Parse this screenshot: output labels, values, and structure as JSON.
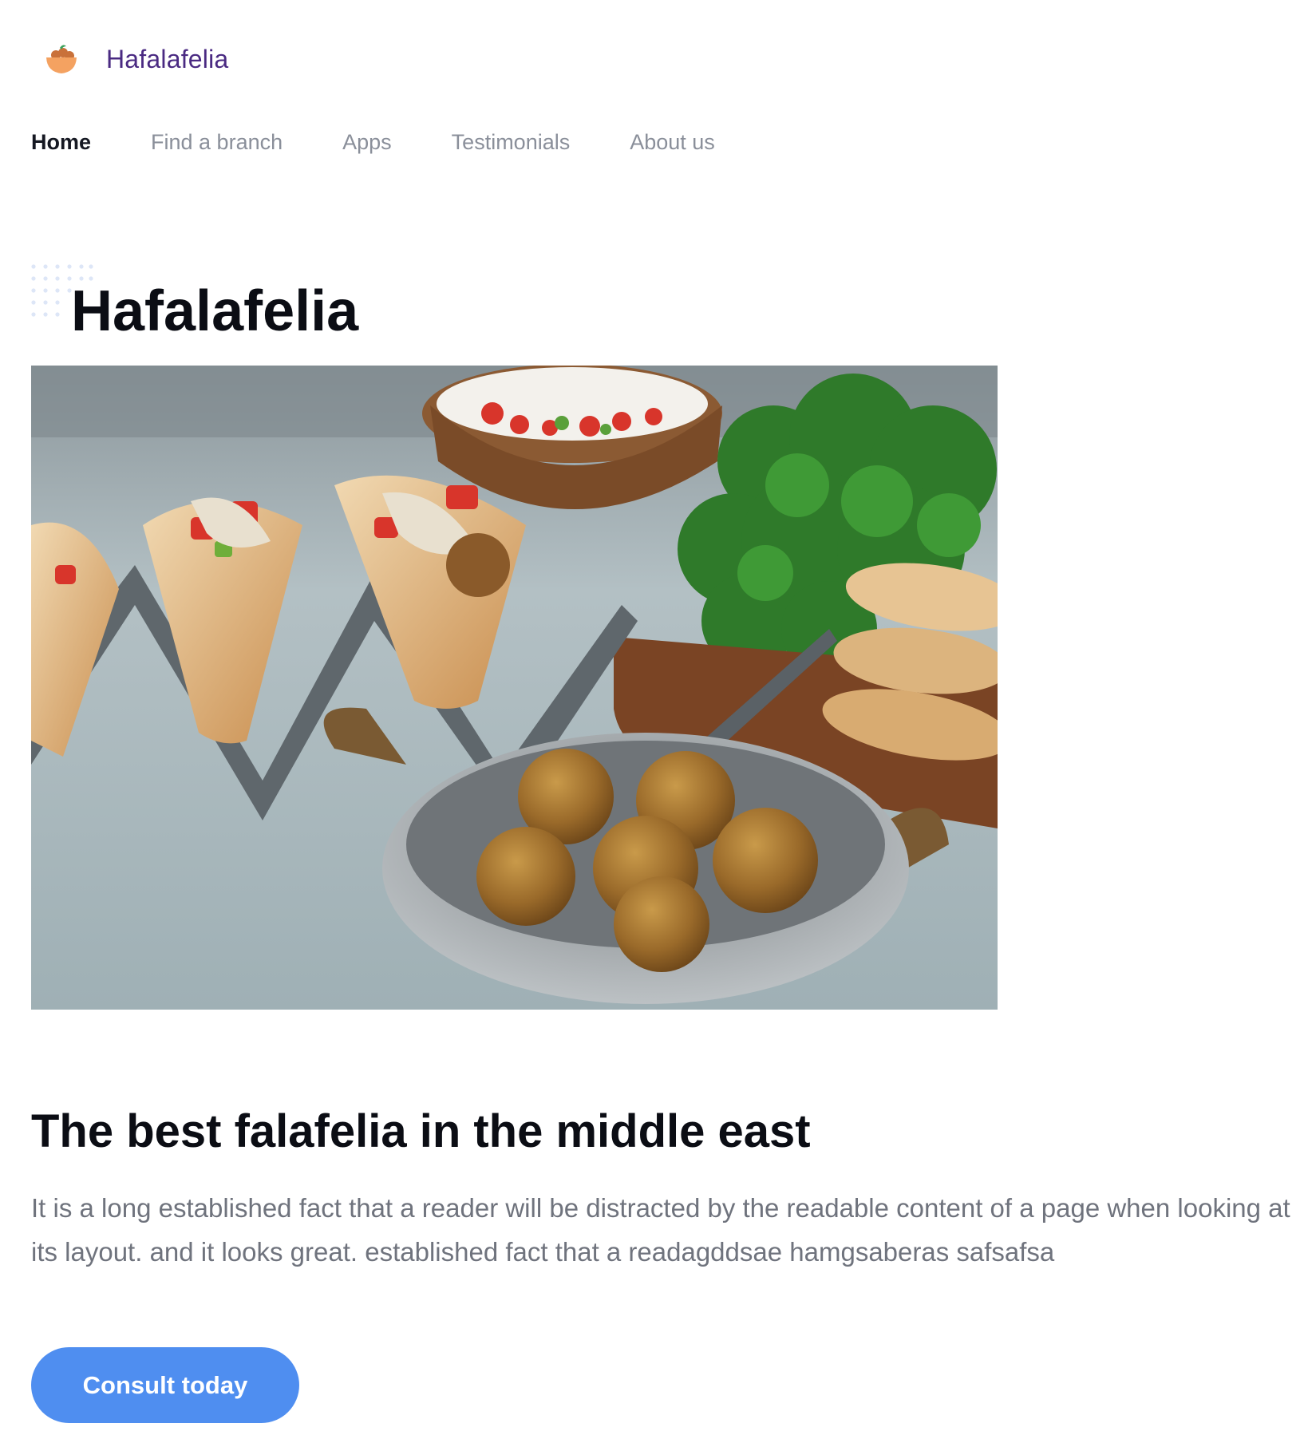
{
  "brand": {
    "name": "Hafalafelia",
    "logo_icon": "falafel-bowl-icon",
    "logo_colors": {
      "bowl": "#f4a261",
      "balls": "#c9713a",
      "leaf": "#3aa05a"
    },
    "name_color": "#4a2a82"
  },
  "nav": {
    "items": [
      {
        "label": "Home",
        "active": true
      },
      {
        "label": "Find a branch",
        "active": false
      },
      {
        "label": "Apps",
        "active": false
      },
      {
        "label": "Testimonials",
        "active": false
      },
      {
        "label": "About us",
        "active": false
      }
    ]
  },
  "hero": {
    "title": "Hafalafelia",
    "decor_icon": "dot-grid-decoration",
    "image": {
      "subject": "falafel-pitas-and-falafel-pan-photo"
    }
  },
  "section": {
    "title": "The best falafelia in the middle east",
    "body": "It is a long established fact that a reader will be distracted by the readable content of a page when looking at its layout. and it looks great. established fact that a readagddsae hamgsaberas safsafsa"
  },
  "cta": {
    "label": "Consult today",
    "color": "#4f8ef0"
  }
}
